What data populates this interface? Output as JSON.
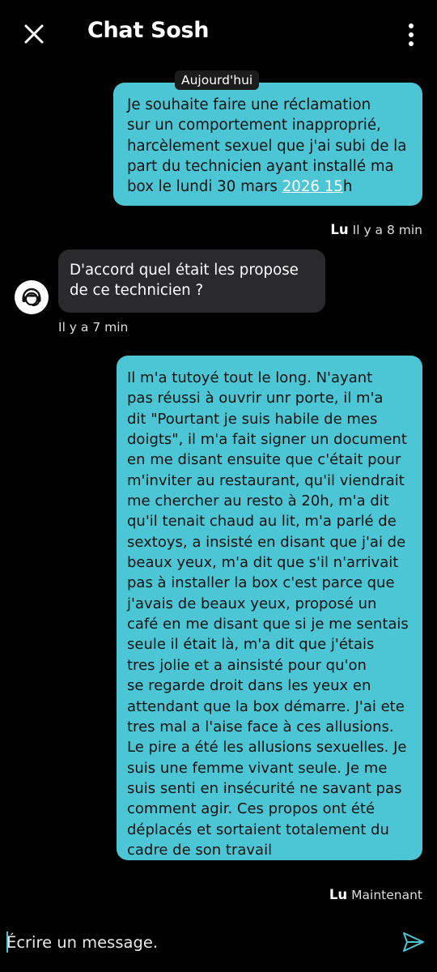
{
  "header": {
    "title": "Chat Sosh",
    "close_icon": "close-icon",
    "menu_icon": "more-vertical-icon"
  },
  "date_separator": "Aujourd'hui",
  "messages": [
    {
      "sender": "user",
      "text_before": "Je souhaite faire une réclamation\nsur un comportement inapproprié,\nharcèlement sexuel que j'ai subi de la\npart du technicien ayant installé ma\nbox le lundi 30 mars ",
      "link_text": "2026 15",
      "text_after": "h",
      "status": "Lu",
      "time": "Il y a 8 min"
    },
    {
      "sender": "agent",
      "avatar_icon": "support-agent-icon",
      "text": "D'accord quel était les propose\nde ce technicien ?",
      "time": "Il y a 7 min"
    },
    {
      "sender": "user",
      "text": "Il m'a tutoyé tout le long. N'ayant\npas réussi à ouvrir unr porte, il m'a\ndit \"Pourtant je suis habile de mes\ndoigts\", il m'a fait signer un document\nen me disant ensuite que c'était pour\nm'inviter au restaurant, qu'il viendrait\nme chercher au resto à 20h, m'a dit\nqu'il tenait chaud au lit, m'a parlé de\nsextoys, a insisté en disant que j'ai de\nbeaux yeux, m'a dit que s'il n'arrivait\npas à installer la box c'est parce que\nj'avais de beaux yeux, proposé un\ncafé en me disant que si je me sentais\nseule il était là, m'a dit que j'étais\ntres jolie et a ainsisté pour qu'on\nse regarde droit dans les yeux en\nattendant que la box démarre. J'ai ete\ntres mal a l'aise face à ces allusions.\nLe pire a été les allusions sexuelles. Je\nsuis une femme vivant seule. Je me\nsuis senti en insécurité ne savant pas\ncomment agir. Ces propos ont été\ndéplacés et sortaient totalement du\ncadre de son travail",
      "status": "Lu",
      "time": "Maintenant"
    }
  ],
  "composer": {
    "placeholder": "Écrire un message.",
    "send_icon": "send-icon"
  },
  "colors": {
    "background": "#000000",
    "user_bubble": "#4cc6d4",
    "agent_bubble": "#2a2a2c"
  }
}
